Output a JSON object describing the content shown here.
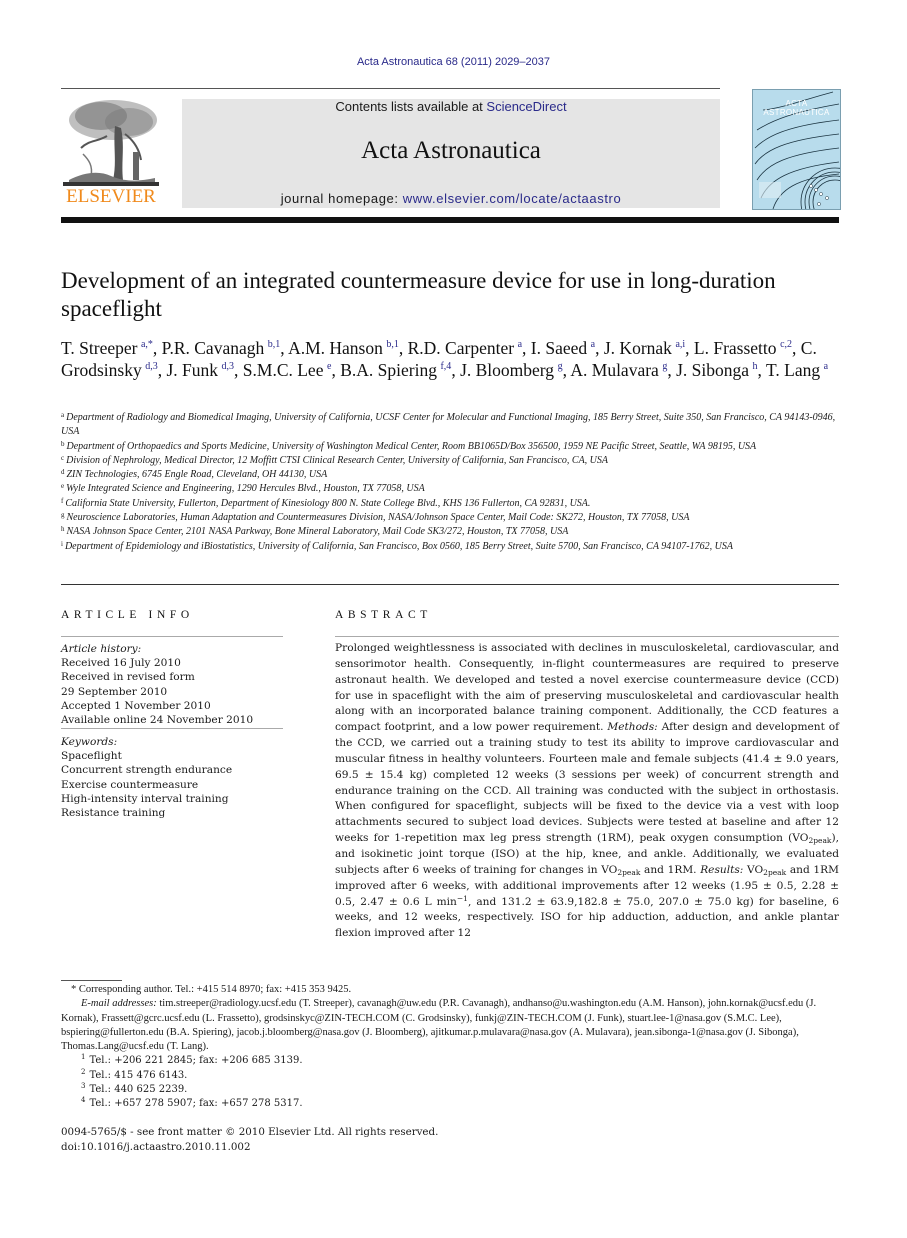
{
  "journal_ref": "Acta Astronautica 68 (2011) 2029–2037",
  "header": {
    "publisher_logo_text": "ELSEVIER",
    "contents_prefix": "Contents lists available at ",
    "contents_link": "ScienceDirect",
    "journal_title": "Acta Astronautica",
    "homepage_prefix": "journal homepage: ",
    "homepage_link": "www.elsevier.com/locate/actaastro",
    "cover_title": "ACTA ASTRONAUTICA"
  },
  "colors": {
    "link": "#2a2a8a",
    "elsevier_orange": "#f08a1c",
    "masthead_bg": "#e5e5e5",
    "cover_bg": "#b8dcec"
  },
  "article": {
    "title": "Development of an integrated countermeasure device for use in long-duration spaceflight",
    "authors": [
      {
        "name": "T. Streeper",
        "marks": "a,*"
      },
      {
        "name": "P.R. Cavanagh",
        "marks": "b,1"
      },
      {
        "name": "A.M. Hanson",
        "marks": "b,1"
      },
      {
        "name": "R.D. Carpenter",
        "marks": "a"
      },
      {
        "name": "I. Saeed",
        "marks": "a"
      },
      {
        "name": "J. Kornak",
        "marks": "a,i"
      },
      {
        "name": "L. Frassetto",
        "marks": "c,2"
      },
      {
        "name": "C. Grodsinsky",
        "marks": "d,3"
      },
      {
        "name": "J. Funk",
        "marks": "d,3"
      },
      {
        "name": "S.M.C. Lee",
        "marks": "e"
      },
      {
        "name": "B.A. Spiering",
        "marks": "f,4"
      },
      {
        "name": "J. Bloomberg",
        "marks": "g"
      },
      {
        "name": "A. Mulavara",
        "marks": "g"
      },
      {
        "name": "J. Sibonga",
        "marks": "h"
      },
      {
        "name": "T. Lang",
        "marks": "a"
      }
    ],
    "affiliations": [
      {
        "key": "a",
        "text": "Department of Radiology and Biomedical Imaging, University of California, UCSF Center for Molecular and Functional Imaging, 185 Berry Street, Suite 350, San Francisco, CA 94143-0946, USA"
      },
      {
        "key": "b",
        "text": "Department of Orthopaedics and Sports Medicine, University of Washington Medical Center, Room BB1065D/Box 356500, 1959 NE Pacific Street, Seattle, WA 98195, USA"
      },
      {
        "key": "c",
        "text": "Division of Nephrology, Medical Director, 12 Moffitt CTSI Clinical Research Center, University of California, San Francisco, CA, USA"
      },
      {
        "key": "d",
        "text": "ZIN Technologies, 6745 Engle Road, Cleveland, OH 44130, USA"
      },
      {
        "key": "e",
        "text": "Wyle Integrated Science and Engineering, 1290 Hercules Blvd., Houston, TX 77058, USA"
      },
      {
        "key": "f",
        "text": "California State University, Fullerton, Department of Kinesiology 800 N. State College Blvd., KHS 136 Fullerton, CA 92831, USA."
      },
      {
        "key": "g",
        "text": "Neuroscience Laboratories, Human Adaptation and Countermeasures Division, NASA/Johnson Space Center, Mail Code: SK272, Houston, TX 77058, USA"
      },
      {
        "key": "h",
        "text": "NASA Johnson Space Center, 2101 NASA Parkway, Bone Mineral Laboratory, Mail Code SK3/272, Houston, TX 77058, USA"
      },
      {
        "key": "i",
        "text": "Department of Epidemiology and iBiostatistics, University of California, San Francisco, Box 0560, 185 Berry Street, Suite 5700, San Francisco, CA 94107-1762, USA"
      }
    ]
  },
  "article_info": {
    "heading": "ARTICLE INFO",
    "history_label": "Article history:",
    "history": [
      "Received 16 July 2010",
      "Received in revised form",
      "29 September 2010",
      "Accepted 1 November 2010",
      "Available online 24 November 2010"
    ],
    "keywords_label": "Keywords:",
    "keywords": [
      "Spaceflight",
      "Concurrent strength endurance",
      "Exercise countermeasure",
      "High-intensity interval training",
      "Resistance training"
    ]
  },
  "abstract": {
    "heading": "ABSTRACT",
    "p1": "Prolonged weightlessness is associated with declines in musculoskeletal, cardiovascular, and sensorimotor health. Consequently, in-flight countermeasures are required to preserve astronaut health. We developed and tested a novel exercise countermeasure device (CCD) for use in spaceflight with the aim of preserving musculoskeletal and cardiovascular health along with an incorporated balance training component. Additionally, the CCD features a compact footprint, and a low power requirement. ",
    "methods_label": "Methods:",
    "p2": " After design and development of the CCD, we carried out a training study to test its ability to improve cardiovascular and muscular fitness in healthy volunteers. Fourteen male and female subjects (41.4 ± 9.0 years, 69.5 ± 15.4 kg) completed 12 weeks (3 sessions per week) of concurrent strength and endurance training on the CCD. All training was conducted with the subject in orthostasis. When configured for spaceflight, subjects will be fixed to the device via a vest with loop attachments secured to subject load devices. Subjects were tested at baseline and after 12 weeks for 1-repetition max leg press strength (1RM), peak oxygen consumption (VO",
    "sub_peak": "2peak",
    "p3": "), and isokinetic joint torque (ISO) at the hip, knee, and ankle. Additionally, we evaluated subjects after 6 weeks of training for changes in VO",
    "p4": " and 1RM. ",
    "results_label": "Results:",
    "p5": " VO",
    "p6": " and 1RM improved after 6 weeks, with additional improvements after 12 weeks (1.95 ± 0.5, 2.28 ± 0.5, 2.47 ± 0.6 L min",
    "sup_minus1": "−1",
    "p7": ", and 131.2 ± 63.9,182.8 ± 75.0, 207.0 ± 75.0 kg) for baseline, 6 weeks, and 12 weeks, respectively. ISO for hip adduction, adduction, and ankle plantar flexion improved after 12"
  },
  "footnotes": {
    "corresponding": "* Corresponding author. Tel.: +415 514 8970; fax: +415 353 9425.",
    "email_label": "E-mail addresses:",
    "emails": " tim.streeper@radiology.ucsf.edu (T. Streeper), cavanagh@uw.edu (P.R. Cavanagh), andhanso@u.washington.edu (A.M. Hanson), john.kornak@ucsf.edu (J. Kornak), Frassett@gcrc.ucsf.edu (L. Frassetto), grodsinskyc@ZIN-TECH.COM (C. Grodsinsky), funkj@ZIN-TECH.COM (J. Funk), stuart.lee-1@nasa.gov (S.M.C. Lee), bspiering@fullerton.edu (B.A. Spiering), jacob.j.bloomberg@nasa.gov (J. Bloomberg), ajitkumar.p.mulavara@nasa.gov (A. Mulavara), jean.sibonga-1@nasa.gov (J. Sibonga), Thomas.Lang@ucsf.edu (T. Lang).",
    "tel": [
      {
        "key": "1",
        "text": "Tel.: +206 221 2845; fax: +206 685 3139."
      },
      {
        "key": "2",
        "text": "Tel.: 415 476 6143."
      },
      {
        "key": "3",
        "text": "Tel.: 440 625 2239."
      },
      {
        "key": "4",
        "text": "Tel.: +657 278 5907; fax: +657 278 5317."
      }
    ]
  },
  "copyright": {
    "line1": "0094-5765/$ - see front matter © 2010 Elsevier Ltd. All rights reserved.",
    "line2": "doi:10.1016/j.actaastro.2010.11.002"
  }
}
